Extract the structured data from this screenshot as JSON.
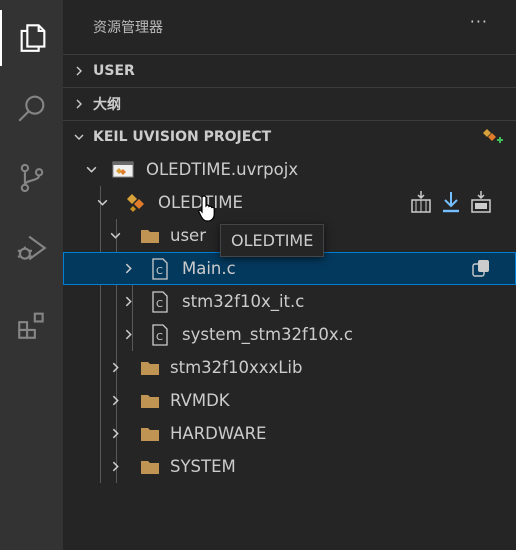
{
  "activity_bar": {
    "items": [
      {
        "name": "explorer-icon",
        "active": true
      },
      {
        "name": "search-icon",
        "active": false
      },
      {
        "name": "source-control-icon",
        "active": false
      },
      {
        "name": "run-debug-icon",
        "active": false
      },
      {
        "name": "extensions-icon",
        "active": false
      }
    ]
  },
  "sidebar": {
    "title": "资源管理器",
    "more_label": "···",
    "sections": [
      {
        "label": "USER",
        "expanded": false
      },
      {
        "label": "大纲",
        "expanded": false
      },
      {
        "label": "KEIL UVISION PROJECT",
        "expanded": true
      }
    ]
  },
  "tree": {
    "project": "OLEDTIME.uvrpojx",
    "target": "OLEDTIME",
    "group_user": "user",
    "files": [
      "Main.c",
      "stm32f10x_it.c",
      "system_stm32f10x.c"
    ],
    "groups": [
      "stm32f10xxxLib",
      "RVMDK",
      "HARDWARE",
      "SYSTEM"
    ],
    "file_badge": "C"
  },
  "tooltip": {
    "text": "OLEDTIME"
  },
  "colors": {
    "background": "#252526",
    "activity_bar": "#333333",
    "selection": "#04395e",
    "selection_border": "#007fd4",
    "folder": "#c09553",
    "accent_blue": "#75beff"
  }
}
